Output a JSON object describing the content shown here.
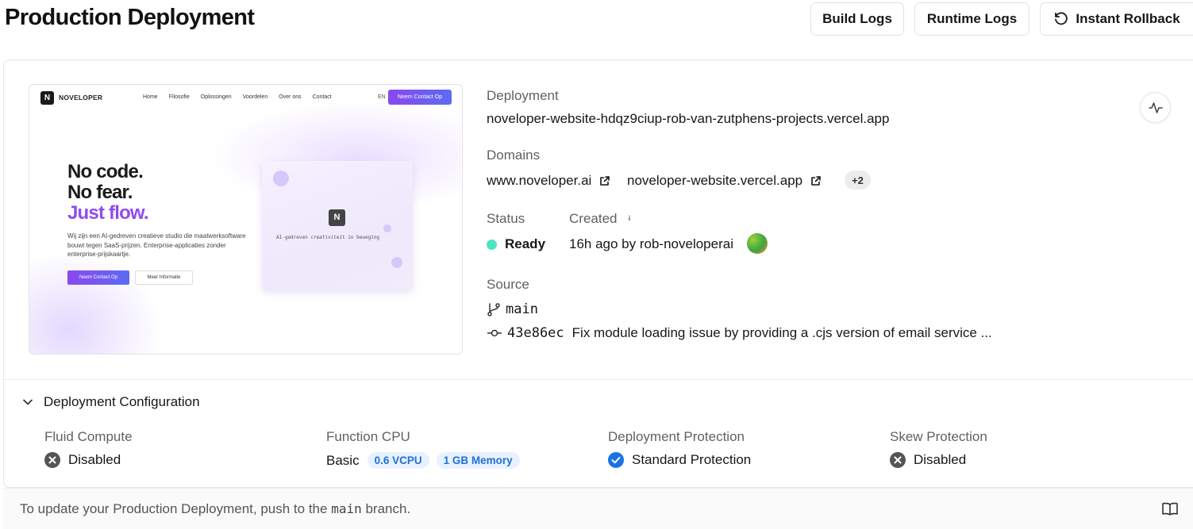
{
  "header": {
    "title": "Production Deployment",
    "build_logs": "Build Logs",
    "runtime_logs": "Runtime Logs",
    "instant_rollback": "Instant Rollback"
  },
  "preview": {
    "logo_mark": "N",
    "logo_text": "NOVELOPER",
    "nav_links": [
      "Home",
      "Filosofie",
      "Oplossingen",
      "Voordelen",
      "Over ons",
      "Contact"
    ],
    "lang": "EN",
    "cta": "Neem Contact Op",
    "headline_1": "No code.",
    "headline_2": "No fear.",
    "headline_3": "Just flow.",
    "description": "Wij zijn een AI-gedreven creatieve studio die maatwerksoftware bouwt tegen SaaS-prijzen. Enterprise-applicaties zonder enterprise-prijskaartje.",
    "primary_button": "Neem Contact Op",
    "secondary_button": "Meer Informatie",
    "mock_text": "AI-gedreven creativiteit in beweging"
  },
  "deployment": {
    "label": "Deployment",
    "url": "noveloper-website-hdqz9ciup-rob-van-zutphens-projects.vercel.app"
  },
  "domains": {
    "label": "Domains",
    "items": [
      "www.noveloper.ai",
      "noveloper-website.vercel.app"
    ],
    "more": "+2"
  },
  "status": {
    "label": "Status",
    "value": "Ready",
    "color": "#50e3c2"
  },
  "created": {
    "label": "Created",
    "value": "16h ago by rob-noveloperai"
  },
  "source": {
    "label": "Source",
    "branch": "main",
    "commit_hash": "43e86ec",
    "commit_message": "Fix module loading issue by providing a .cjs version of email service ..."
  },
  "config": {
    "title": "Deployment Configuration",
    "fluid_compute": {
      "label": "Fluid Compute",
      "value": "Disabled",
      "icon": "x-circle-icon"
    },
    "function_cpu": {
      "label": "Function CPU",
      "value": "Basic",
      "chip_cpu": "0.6 VCPU",
      "chip_memory": "1 GB Memory"
    },
    "deployment_protection": {
      "label": "Deployment Protection",
      "value": "Standard Protection",
      "icon": "check-circle-icon"
    },
    "skew_protection": {
      "label": "Skew Protection",
      "value": "Disabled",
      "icon": "x-circle-icon"
    }
  },
  "footer": {
    "text_before": "To update your Production Deployment, push to the",
    "branch": "main",
    "text_after": "branch."
  },
  "colors": {
    "accent_purple": "#8e4bf0",
    "chip_blue": "#1f6fd6",
    "check_blue": "#1a73e8"
  }
}
